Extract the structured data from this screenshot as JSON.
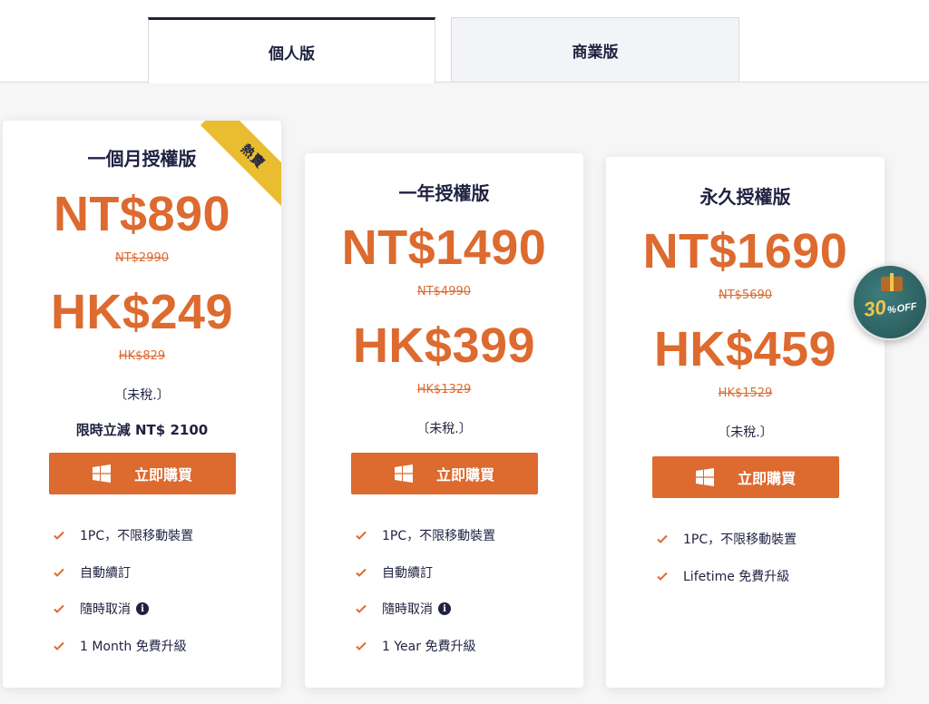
{
  "tabs": [
    {
      "label": "個人版",
      "active": true
    },
    {
      "label": "商業版",
      "active": false
    }
  ],
  "plans": [
    {
      "title": "一個月授權版",
      "ribbon": "熱賣",
      "price_nt": "NT$890",
      "old_nt": "NT$2990",
      "price_hk": "HK$249",
      "old_hk": "HK$829",
      "tax": "〔未稅.〕",
      "promo": "限時立減 NT$ 2100",
      "buy_label": "立即購買",
      "features": [
        "1PC，不限移動裝置",
        "自動續訂",
        "隨時取消",
        "1 Month 免費升級"
      ]
    },
    {
      "title": "一年授權版",
      "price_nt": "NT$1490",
      "old_nt": "NT$4990",
      "price_hk": "HK$399",
      "old_hk": "HK$1329",
      "tax": "〔未稅.〕",
      "buy_label": "立即購買",
      "features": [
        "1PC，不限移動裝置",
        "自動續訂",
        "隨時取消",
        "1 Year 免費升級"
      ]
    },
    {
      "title": "永久授權版",
      "price_nt": "NT$1690",
      "old_nt": "NT$5690",
      "price_hk": "HK$459",
      "old_hk": "HK$1529",
      "tax": "〔未稅.〕",
      "buy_label": "立即購買",
      "features": [
        "1PC，不限移動裝置",
        "Lifetime 免費升級"
      ]
    }
  ],
  "badge": {
    "value": "30",
    "unit": "%",
    "off": "OFF"
  },
  "icons": {
    "check": "check-icon",
    "windows": "windows-icon",
    "info": "info-icon",
    "badge": "discount-badge-icon"
  },
  "colors": {
    "accent": "#dd6a2f",
    "navy": "#1f2140",
    "ribbon": "#e9bd2f",
    "badge": "#2c5f60"
  },
  "info_glyph": "i"
}
